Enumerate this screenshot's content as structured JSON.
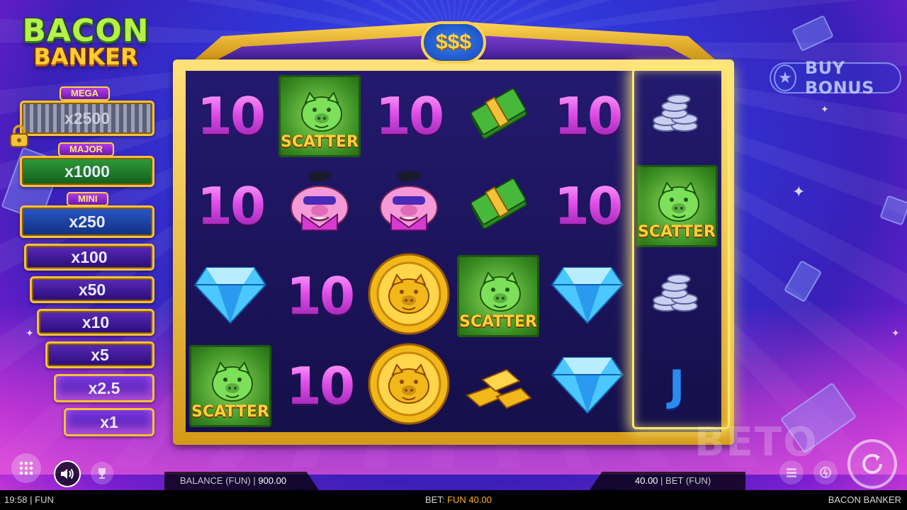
{
  "logo": {
    "line1": "BACON",
    "line2": "BANKER"
  },
  "jackpots": {
    "mega": {
      "label": "MEGA",
      "value": "x2500",
      "locked": true
    },
    "major": {
      "label": "MAJOR",
      "value": "x1000"
    },
    "mini": {
      "label": "MINI",
      "value": "x250"
    },
    "ladder": [
      "x100",
      "x50",
      "x10",
      "x5",
      "x2.5",
      "x1"
    ]
  },
  "header_badge": "$$$",
  "grid": {
    "cols": 6,
    "rows": 4,
    "cells": [
      [
        "ten",
        "scatter",
        "ten",
        "cash",
        "ten",
        "coins"
      ],
      [
        "ten",
        "pig",
        "pig",
        "cash",
        "ten",
        "scatter"
      ],
      [
        "diamond",
        "ten",
        "gold-coin",
        "scatter",
        "diamond",
        "coins"
      ],
      [
        "scatter",
        "ten",
        "gold-coin",
        "gold-bars",
        "diamond",
        "j"
      ]
    ],
    "ten_label": "10",
    "j_label": "J",
    "scatter_label": "SCATTER"
  },
  "buy_bonus": {
    "label": "BUY BONUS"
  },
  "balance": {
    "label": "BALANCE (FUN)",
    "value": "900.00"
  },
  "bet": {
    "label": "BET",
    "currency": "(FUN)",
    "value": "40.00"
  },
  "status": {
    "time_mode": "19:58 | FUN",
    "bet_prefix": "BET:",
    "bet_amount": "FUN 40.00",
    "game_name": "BACON BANKER"
  },
  "colors": {
    "accent_gold": "#ffd24a",
    "win_highlight": "#ffe66a",
    "bet_amount": "#ffb020"
  }
}
